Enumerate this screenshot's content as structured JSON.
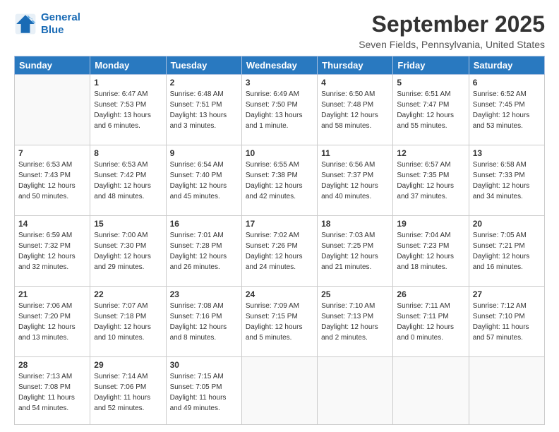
{
  "header": {
    "logo_line1": "General",
    "logo_line2": "Blue",
    "month_year": "September 2025",
    "location": "Seven Fields, Pennsylvania, United States"
  },
  "days_of_week": [
    "Sunday",
    "Monday",
    "Tuesday",
    "Wednesday",
    "Thursday",
    "Friday",
    "Saturday"
  ],
  "weeks": [
    [
      {
        "day": "",
        "sunrise": "",
        "sunset": "",
        "daylight": ""
      },
      {
        "day": "1",
        "sunrise": "Sunrise: 6:47 AM",
        "sunset": "Sunset: 7:53 PM",
        "daylight": "Daylight: 13 hours and 6 minutes."
      },
      {
        "day": "2",
        "sunrise": "Sunrise: 6:48 AM",
        "sunset": "Sunset: 7:51 PM",
        "daylight": "Daylight: 13 hours and 3 minutes."
      },
      {
        "day": "3",
        "sunrise": "Sunrise: 6:49 AM",
        "sunset": "Sunset: 7:50 PM",
        "daylight": "Daylight: 13 hours and 1 minute."
      },
      {
        "day": "4",
        "sunrise": "Sunrise: 6:50 AM",
        "sunset": "Sunset: 7:48 PM",
        "daylight": "Daylight: 12 hours and 58 minutes."
      },
      {
        "day": "5",
        "sunrise": "Sunrise: 6:51 AM",
        "sunset": "Sunset: 7:47 PM",
        "daylight": "Daylight: 12 hours and 55 minutes."
      },
      {
        "day": "6",
        "sunrise": "Sunrise: 6:52 AM",
        "sunset": "Sunset: 7:45 PM",
        "daylight": "Daylight: 12 hours and 53 minutes."
      }
    ],
    [
      {
        "day": "7",
        "sunrise": "Sunrise: 6:53 AM",
        "sunset": "Sunset: 7:43 PM",
        "daylight": "Daylight: 12 hours and 50 minutes."
      },
      {
        "day": "8",
        "sunrise": "Sunrise: 6:53 AM",
        "sunset": "Sunset: 7:42 PM",
        "daylight": "Daylight: 12 hours and 48 minutes."
      },
      {
        "day": "9",
        "sunrise": "Sunrise: 6:54 AM",
        "sunset": "Sunset: 7:40 PM",
        "daylight": "Daylight: 12 hours and 45 minutes."
      },
      {
        "day": "10",
        "sunrise": "Sunrise: 6:55 AM",
        "sunset": "Sunset: 7:38 PM",
        "daylight": "Daylight: 12 hours and 42 minutes."
      },
      {
        "day": "11",
        "sunrise": "Sunrise: 6:56 AM",
        "sunset": "Sunset: 7:37 PM",
        "daylight": "Daylight: 12 hours and 40 minutes."
      },
      {
        "day": "12",
        "sunrise": "Sunrise: 6:57 AM",
        "sunset": "Sunset: 7:35 PM",
        "daylight": "Daylight: 12 hours and 37 minutes."
      },
      {
        "day": "13",
        "sunrise": "Sunrise: 6:58 AM",
        "sunset": "Sunset: 7:33 PM",
        "daylight": "Daylight: 12 hours and 34 minutes."
      }
    ],
    [
      {
        "day": "14",
        "sunrise": "Sunrise: 6:59 AM",
        "sunset": "Sunset: 7:32 PM",
        "daylight": "Daylight: 12 hours and 32 minutes."
      },
      {
        "day": "15",
        "sunrise": "Sunrise: 7:00 AM",
        "sunset": "Sunset: 7:30 PM",
        "daylight": "Daylight: 12 hours and 29 minutes."
      },
      {
        "day": "16",
        "sunrise": "Sunrise: 7:01 AM",
        "sunset": "Sunset: 7:28 PM",
        "daylight": "Daylight: 12 hours and 26 minutes."
      },
      {
        "day": "17",
        "sunrise": "Sunrise: 7:02 AM",
        "sunset": "Sunset: 7:26 PM",
        "daylight": "Daylight: 12 hours and 24 minutes."
      },
      {
        "day": "18",
        "sunrise": "Sunrise: 7:03 AM",
        "sunset": "Sunset: 7:25 PM",
        "daylight": "Daylight: 12 hours and 21 minutes."
      },
      {
        "day": "19",
        "sunrise": "Sunrise: 7:04 AM",
        "sunset": "Sunset: 7:23 PM",
        "daylight": "Daylight: 12 hours and 18 minutes."
      },
      {
        "day": "20",
        "sunrise": "Sunrise: 7:05 AM",
        "sunset": "Sunset: 7:21 PM",
        "daylight": "Daylight: 12 hours and 16 minutes."
      }
    ],
    [
      {
        "day": "21",
        "sunrise": "Sunrise: 7:06 AM",
        "sunset": "Sunset: 7:20 PM",
        "daylight": "Daylight: 12 hours and 13 minutes."
      },
      {
        "day": "22",
        "sunrise": "Sunrise: 7:07 AM",
        "sunset": "Sunset: 7:18 PM",
        "daylight": "Daylight: 12 hours and 10 minutes."
      },
      {
        "day": "23",
        "sunrise": "Sunrise: 7:08 AM",
        "sunset": "Sunset: 7:16 PM",
        "daylight": "Daylight: 12 hours and 8 minutes."
      },
      {
        "day": "24",
        "sunrise": "Sunrise: 7:09 AM",
        "sunset": "Sunset: 7:15 PM",
        "daylight": "Daylight: 12 hours and 5 minutes."
      },
      {
        "day": "25",
        "sunrise": "Sunrise: 7:10 AM",
        "sunset": "Sunset: 7:13 PM",
        "daylight": "Daylight: 12 hours and 2 minutes."
      },
      {
        "day": "26",
        "sunrise": "Sunrise: 7:11 AM",
        "sunset": "Sunset: 7:11 PM",
        "daylight": "Daylight: 12 hours and 0 minutes."
      },
      {
        "day": "27",
        "sunrise": "Sunrise: 7:12 AM",
        "sunset": "Sunset: 7:10 PM",
        "daylight": "Daylight: 11 hours and 57 minutes."
      }
    ],
    [
      {
        "day": "28",
        "sunrise": "Sunrise: 7:13 AM",
        "sunset": "Sunset: 7:08 PM",
        "daylight": "Daylight: 11 hours and 54 minutes."
      },
      {
        "day": "29",
        "sunrise": "Sunrise: 7:14 AM",
        "sunset": "Sunset: 7:06 PM",
        "daylight": "Daylight: 11 hours and 52 minutes."
      },
      {
        "day": "30",
        "sunrise": "Sunrise: 7:15 AM",
        "sunset": "Sunset: 7:05 PM",
        "daylight": "Daylight: 11 hours and 49 minutes."
      },
      {
        "day": "",
        "sunrise": "",
        "sunset": "",
        "daylight": ""
      },
      {
        "day": "",
        "sunrise": "",
        "sunset": "",
        "daylight": ""
      },
      {
        "day": "",
        "sunrise": "",
        "sunset": "",
        "daylight": ""
      },
      {
        "day": "",
        "sunrise": "",
        "sunset": "",
        "daylight": ""
      }
    ]
  ]
}
